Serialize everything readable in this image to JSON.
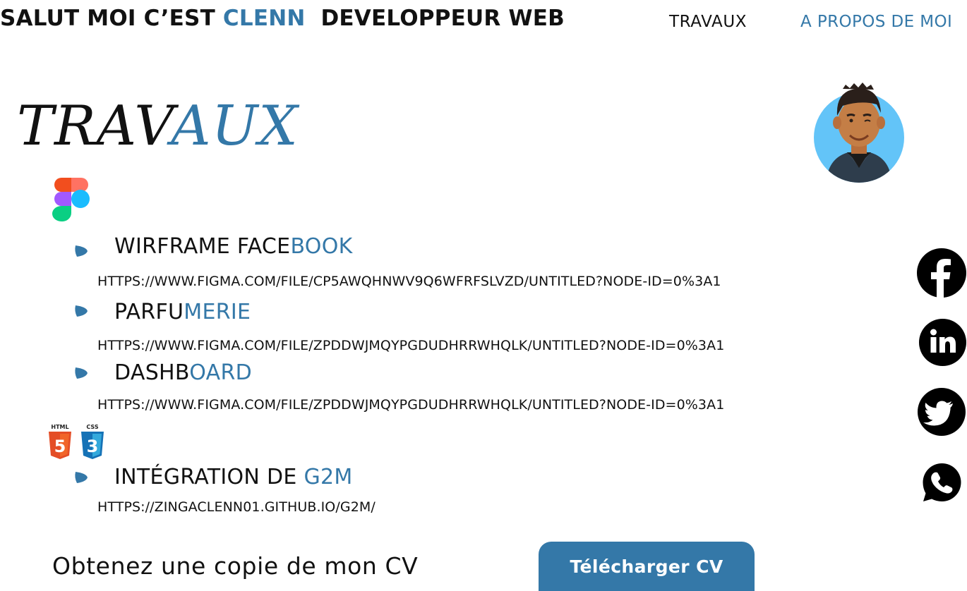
{
  "header": {
    "brand_prefix": "SALUT MOI C’EST ",
    "brand_name": "CLENN",
    "brand_suffix": "  DEVELOPPEUR WEB",
    "nav": {
      "travaux": "TRAVAUX",
      "apropos": "A PROPOS DE MOI"
    }
  },
  "section": {
    "title_part1": "TRAV",
    "title_part2": "AUX"
  },
  "figma_projects": [
    {
      "title_part1": "WIRFRAME FACE",
      "title_part2": "BOOK",
      "link": "HTTPS://WWW.FIGMA.COM/FILE/CP5AWQHNWV9Q6WFRFSLVZD/UNTITLED?NODE-ID=0%3A1"
    },
    {
      "title_part1": "PARFU",
      "title_part2": "MERIE",
      "link": "HTTPS://WWW.FIGMA.COM/FILE/ZPDDWJMQYPGDUDHRRWHQLK/UNTITLED?NODE-ID=0%3A1"
    },
    {
      "title_part1": "DASHB",
      "title_part2": "OARD",
      "link": "HTTPS://WWW.FIGMA.COM/FILE/ZPDDWJMQYPGDUDHRRWHQLK/UNTITLED?NODE-ID=0%3A1"
    }
  ],
  "web_projects": [
    {
      "title_part1": "INTÉGRATION DE ",
      "title_part2": "G2M",
      "link": "HTTPS://ZINGACLENN01.GITHUB.IO/G2M/"
    }
  ],
  "icons": {
    "figma": "figma-icon",
    "html_label": "HTML",
    "html_digit": "5",
    "css_label": "CSS",
    "css_digit": "3",
    "social": [
      "facebook-icon",
      "linkedin-icon",
      "twitter-icon",
      "whatsapp-icon"
    ]
  },
  "cta": {
    "text": "Obtenez une copie de mon CV",
    "button": "Télécharger CV"
  },
  "colors": {
    "accent": "#3478a8",
    "text": "#111111",
    "avatar_bg": "#63c4f8",
    "html_orange": "#e44d26",
    "css_blue": "#2965f1"
  }
}
